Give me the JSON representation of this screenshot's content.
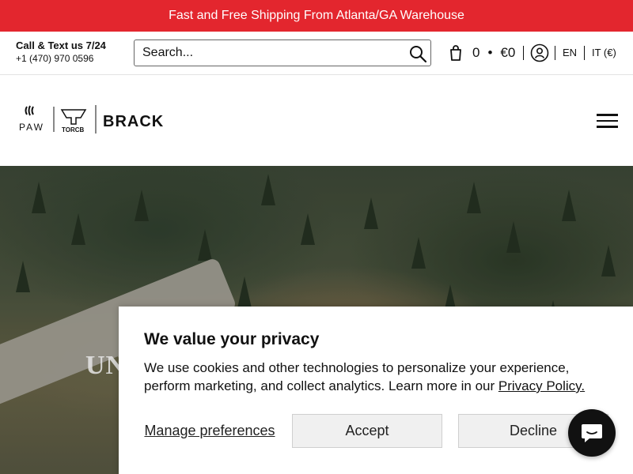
{
  "announcement": {
    "text": "Fast and Free Shipping From Atlanta/GA Warehouse"
  },
  "contact": {
    "line1": "Call & Text us 7/24",
    "phone": "+1 (470) 970 0596"
  },
  "search": {
    "placeholder": "Search...",
    "icon": "search-icon"
  },
  "cart": {
    "count": "0",
    "separator": "•",
    "total": "€0",
    "icon": "cart-icon"
  },
  "account": {
    "icon": "account-icon"
  },
  "locale": {
    "language": "EN",
    "currency": "IT (€)"
  },
  "logo": {
    "brands": [
      "PAW",
      "TORCB",
      "BRACK"
    ]
  },
  "menu": {
    "icon": "hamburger-menu-icon"
  },
  "hero": {
    "visible_text": "UN"
  },
  "cookie_banner": {
    "title": "We value your privacy",
    "body": "We use cookies and other technologies to personalize your experience, perform marketing, and collect analytics. Learn more in our ",
    "policy_link": "Privacy Policy.",
    "manage_label": "Manage preferences",
    "accept_label": "Accept",
    "decline_label": "Decline"
  },
  "chat": {
    "icon": "chat-bubble-icon"
  },
  "colors": {
    "accent": "#e3262e",
    "chat_bg": "#111111"
  }
}
